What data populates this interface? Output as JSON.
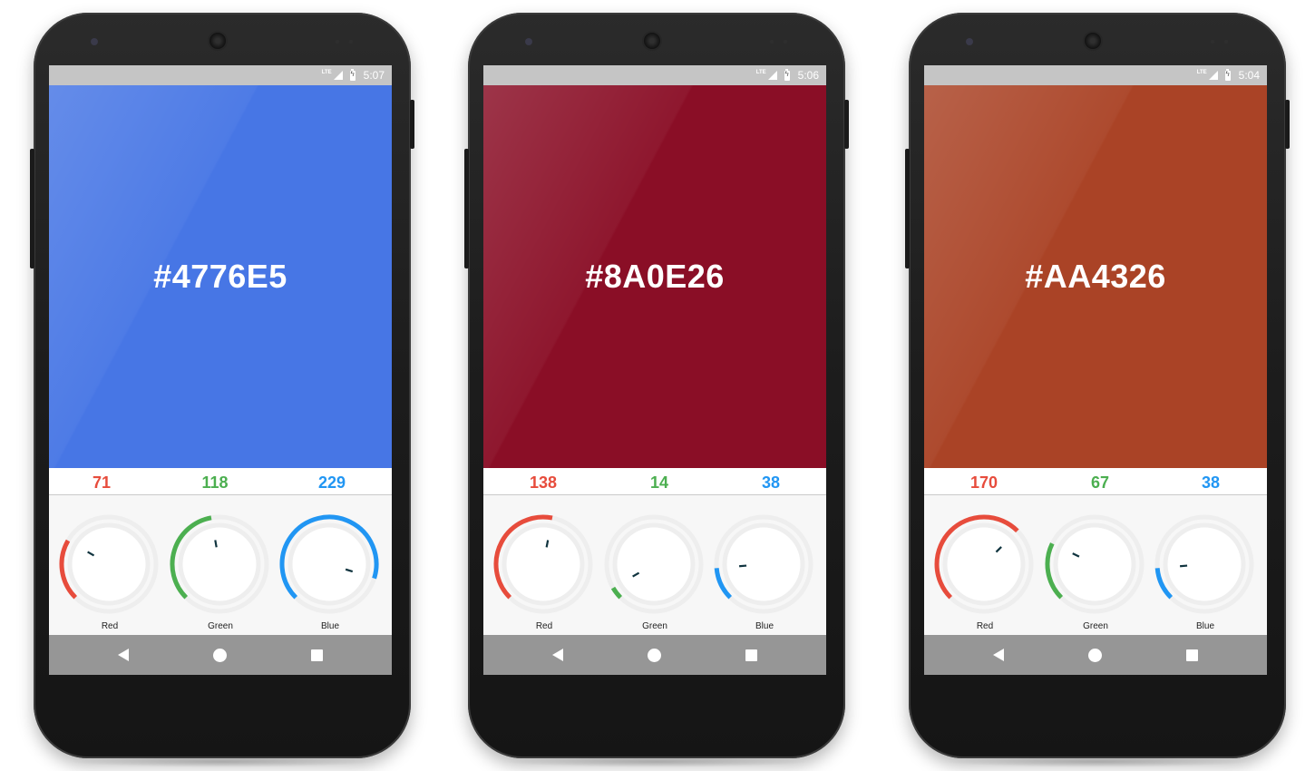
{
  "colors": {
    "red": "#e74c3c",
    "green": "#4caf50",
    "blue": "#2196f3",
    "track": "#eeeeee",
    "pointer": "#10343f"
  },
  "phones": [
    {
      "color_hex": "#4776E5",
      "statusbar": {
        "network": "LTE",
        "time": "5:07"
      },
      "channels": [
        {
          "name": "Red",
          "value": "71",
          "level": 0.278
        },
        {
          "name": "Green",
          "value": "118",
          "level": 0.463
        },
        {
          "name": "Blue",
          "value": "229",
          "level": 0.898
        }
      ],
      "nav": [
        "back-icon",
        "home-icon",
        "recents-icon"
      ]
    },
    {
      "color_hex": "#8A0E26",
      "statusbar": {
        "network": "LTE",
        "time": "5:06"
      },
      "channels": [
        {
          "name": "Red",
          "value": "138",
          "level": 0.541
        },
        {
          "name": "Green",
          "value": "14",
          "level": 0.055
        },
        {
          "name": "Blue",
          "value": "38",
          "level": 0.149
        }
      ],
      "nav": [
        "back-icon",
        "home-icon",
        "recents-icon"
      ]
    },
    {
      "color_hex": "#AA4326",
      "statusbar": {
        "network": "LTE",
        "time": "5:04"
      },
      "channels": [
        {
          "name": "Red",
          "value": "170",
          "level": 0.667
        },
        {
          "name": "Green",
          "value": "67",
          "level": 0.263
        },
        {
          "name": "Blue",
          "value": "38",
          "level": 0.149
        }
      ],
      "nav": [
        "back-icon",
        "home-icon",
        "recents-icon"
      ]
    }
  ]
}
